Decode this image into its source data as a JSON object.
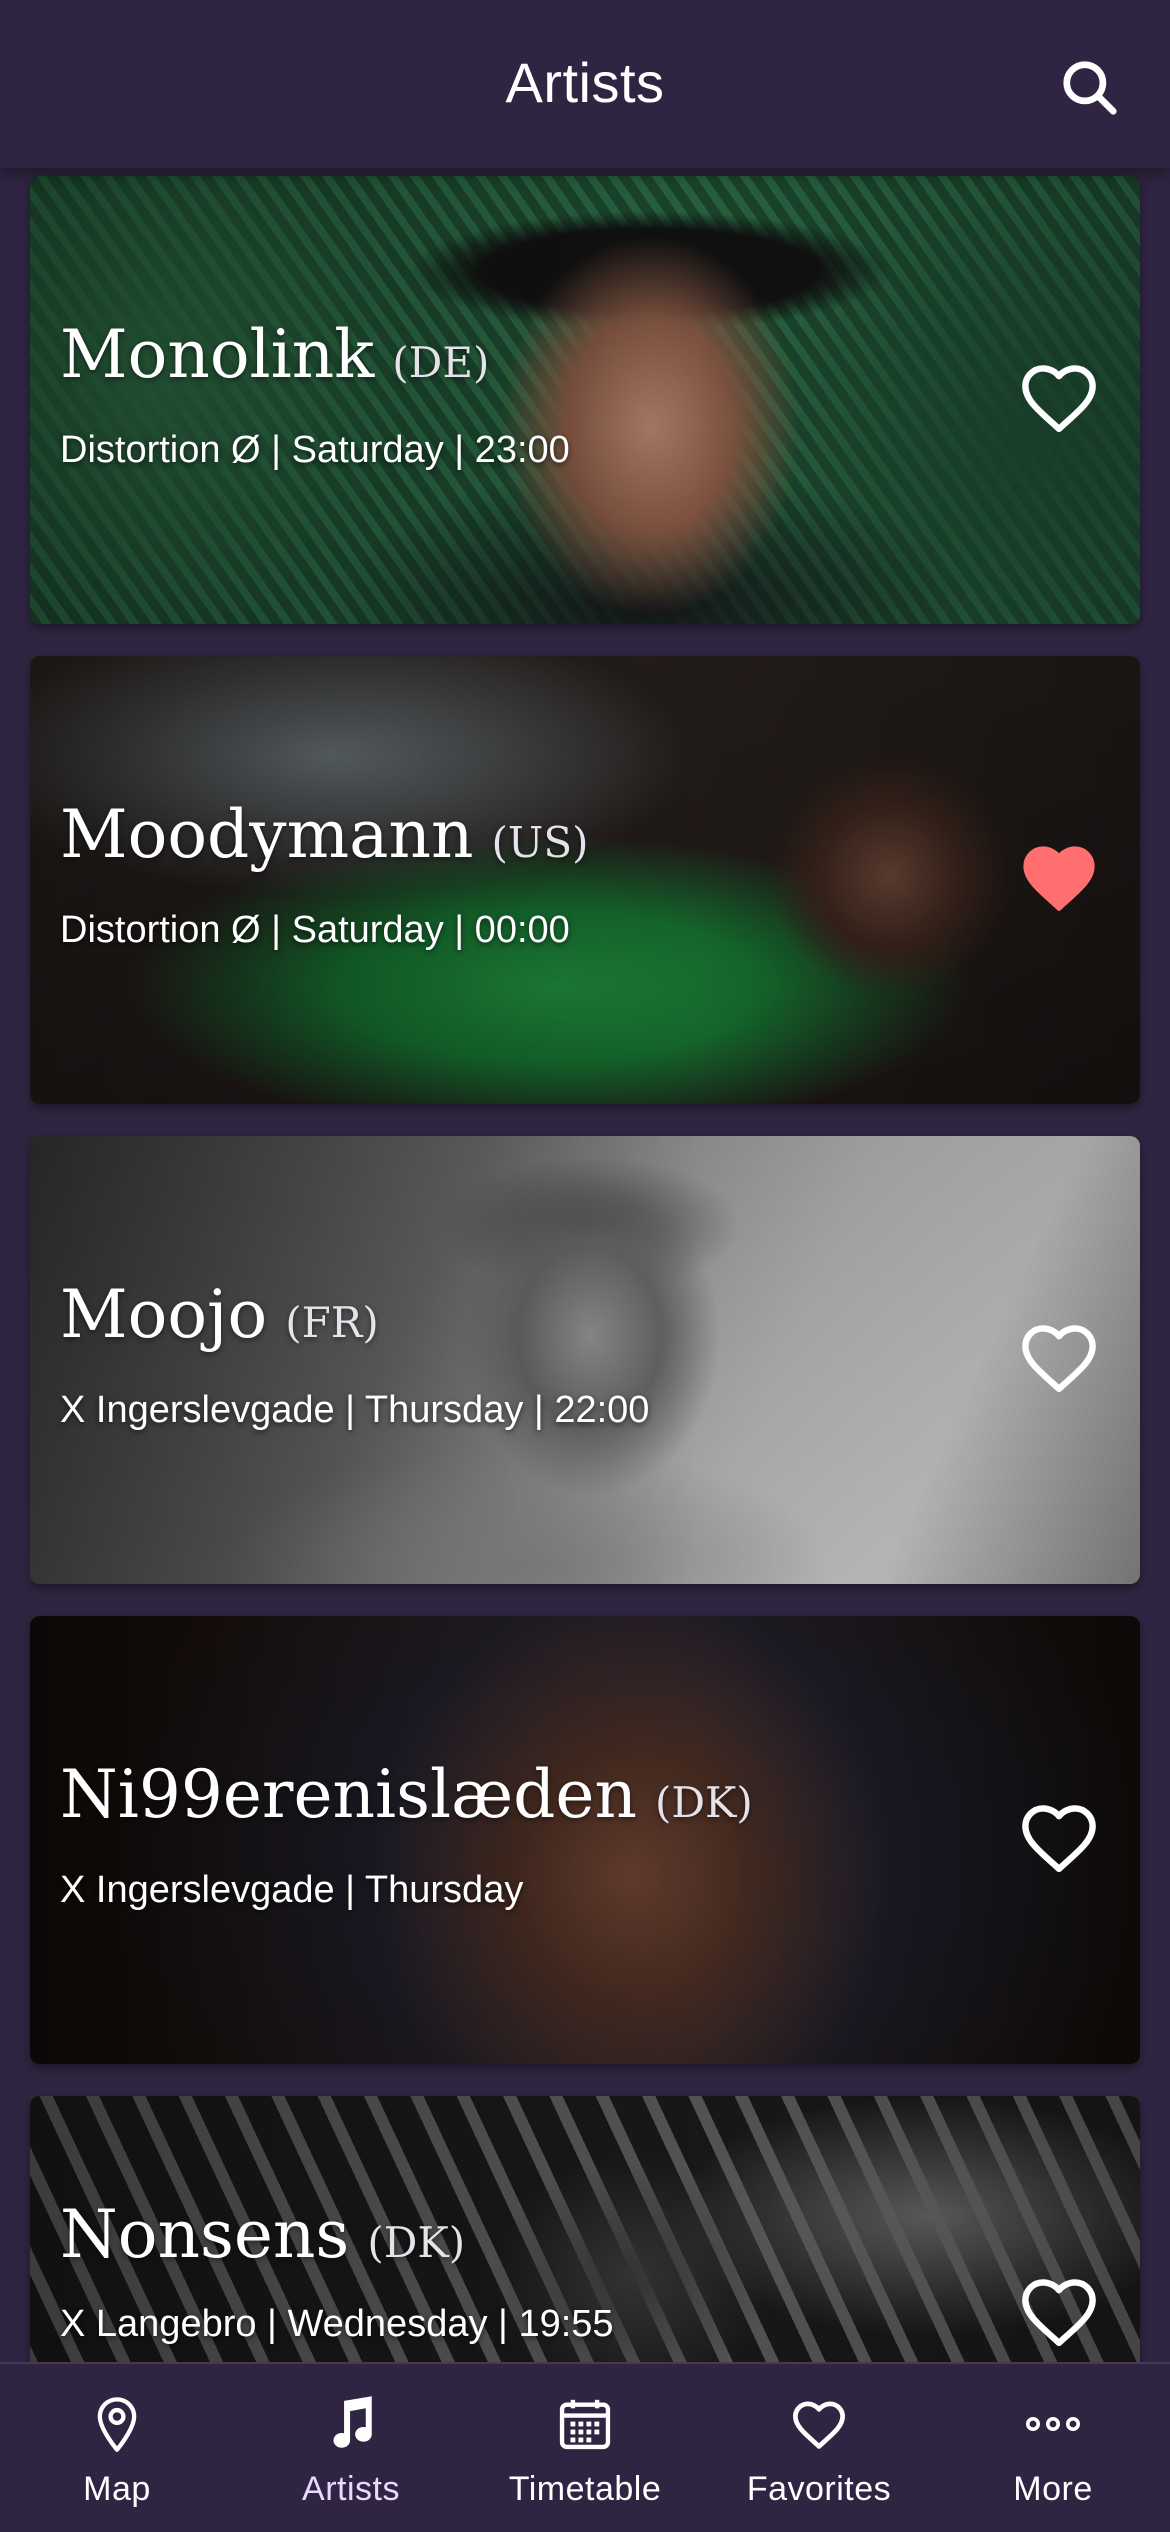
{
  "header": {
    "title": "Artists",
    "search_icon": "search-icon"
  },
  "colors": {
    "background": "#2f2542",
    "favorite_active": "#ff6f6f",
    "text": "#ffffff"
  },
  "artists": [
    {
      "name": "Monolink",
      "country": "(DE)",
      "info": "Distortion Ø | Saturday | 23:00",
      "favorite": false
    },
    {
      "name": "Moodymann",
      "country": "(US)",
      "info": "Distortion Ø | Saturday | 00:00",
      "favorite": true
    },
    {
      "name": "Moojo",
      "country": "(FR)",
      "info": "X Ingerslevgade | Thursday | 22:00",
      "favorite": false
    },
    {
      "name": "Ni99erenislæden",
      "country": "(DK)",
      "info": "X Ingerslevgade | Thursday",
      "favorite": false
    },
    {
      "name": "Nonsens",
      "country": "(DK)",
      "info": "X Langebro | Wednesday | 19:55",
      "favorite": false
    }
  ],
  "tabbar": {
    "items": [
      {
        "label": "Map",
        "icon": "map-pin-icon"
      },
      {
        "label": "Artists",
        "icon": "music-note-icon",
        "active": true
      },
      {
        "label": "Timetable",
        "icon": "calendar-icon"
      },
      {
        "label": "Favorites",
        "icon": "heart-icon"
      },
      {
        "label": "More",
        "icon": "more-dots-icon"
      }
    ]
  }
}
